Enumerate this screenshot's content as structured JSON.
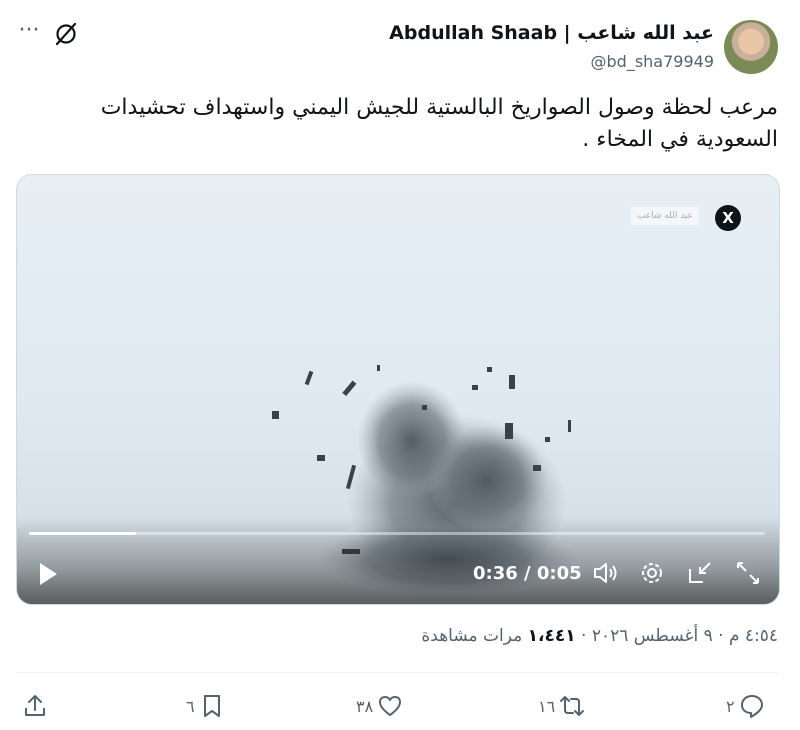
{
  "author": {
    "display_name": "Abdullah Shaab | عبد الله شاعب",
    "handle": "@bd_sha79949"
  },
  "tweet": {
    "text": "مرعب لحظة وصول الصواريخ البالستية للجيش اليمني واستهداف تحشيدات السعودية في المخاء ."
  },
  "media": {
    "watermark": "عبد الله شاعب",
    "logo": "X",
    "time_display": "0:36 / 0:05",
    "progress": 0.145
  },
  "meta": {
    "time": "٤:٥٤ م",
    "date": "٩ أغسطس ٢٠٢٦",
    "separator": "·",
    "views_count": "١،٤٤١",
    "views_label": "مرات مشاهدة"
  },
  "actions": {
    "replies": "٢",
    "reposts": "١٦",
    "likes": "٣٨",
    "bookmarks": "٦"
  },
  "colors": {
    "text": "#0f1419",
    "secondary": "#536471",
    "divider": "#eff3f4"
  },
  "icons": [
    "more-icon",
    "grok-icon",
    "x-logo-icon",
    "play-icon",
    "volume-icon",
    "settings-icon",
    "pip-icon",
    "fullscreen-icon",
    "reply-icon",
    "repost-icon",
    "like-icon",
    "bookmark-icon",
    "share-icon"
  ]
}
